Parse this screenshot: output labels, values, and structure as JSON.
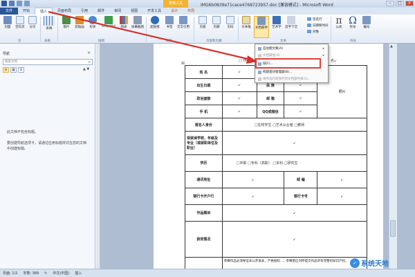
{
  "titlebar": {
    "context_tab": "表格工具",
    "title": "IMG6b0839e71cace4768723957.doc [兼容模式] - Microsoft Word"
  },
  "tabs": [
    "文件",
    "开始",
    "插入",
    "页面布局",
    "引用",
    "邮件",
    "审阅",
    "视图",
    "开发工具",
    "设计",
    "布局"
  ],
  "ribbon": {
    "buttons": [
      "封面",
      "空白页",
      "分页",
      "表格",
      "图片",
      "剪贴画",
      "形状",
      "SmartArt",
      "图表",
      "屏幕截图",
      "超链接",
      "书签",
      "交叉引用",
      "页眉",
      "页脚",
      "页码",
      "文本框",
      "文档部件",
      "艺术字",
      "首字下沉",
      "公式",
      "符号",
      "编号"
    ],
    "small_buttons": [
      "签名行",
      "日期和时间",
      "对象"
    ],
    "groups": [
      "页",
      "表格",
      "插图",
      "链接",
      "页眉和页脚",
      "文本",
      "符号"
    ]
  },
  "nav": {
    "title": "导航",
    "search_placeholder": "搜索文档",
    "no_headings": "此文档不包含标题。",
    "help": "要创建导航选项卡，请通过应用标题样式在您的文档中创建标题。"
  },
  "menu": {
    "items": [
      "自动图文集(A)",
      "文档属性(D)",
      "域(F)...",
      "构建基块管理器(B)...",
      "将所选内容保存到文档部件库(S)..."
    ]
  },
  "form": {
    "above_left": "□ 作品之考...",
    "above_right": "名↙",
    "name": "姓 名",
    "gender": "性 别",
    "birth": "出生日期",
    "ethnic": "民 族",
    "photo": "照片",
    "politics": "政治面貌",
    "email": "邮 箱",
    "phone": "手 机",
    "qq": "QQ或微信",
    "identity": "报名人身份",
    "identity_options": "□在校学生   □艺术从业者   □教师",
    "school": "现就读学校、年级及专业（或就职单位及职业）",
    "education": "学历",
    "education_options": "□中职   □专科（高职）   □本科   □研究生",
    "address": "通讯地址",
    "postcode": "邮 编",
    "bank_name": "银行卡开户行",
    "bank_no": "银行卡号",
    "work_title": "作品题目",
    "award": "获奖情况",
    "statement": "参赛作品必须保证未公开发表，严格按照...，参赛者应对所提交作品享有完整的知识产权。"
  },
  "status": {
    "page": "页面: 1/2",
    "words": "字数: 389",
    "lang": "中文(中国)",
    "mode": "插入"
  },
  "watermark": "系统天地"
}
